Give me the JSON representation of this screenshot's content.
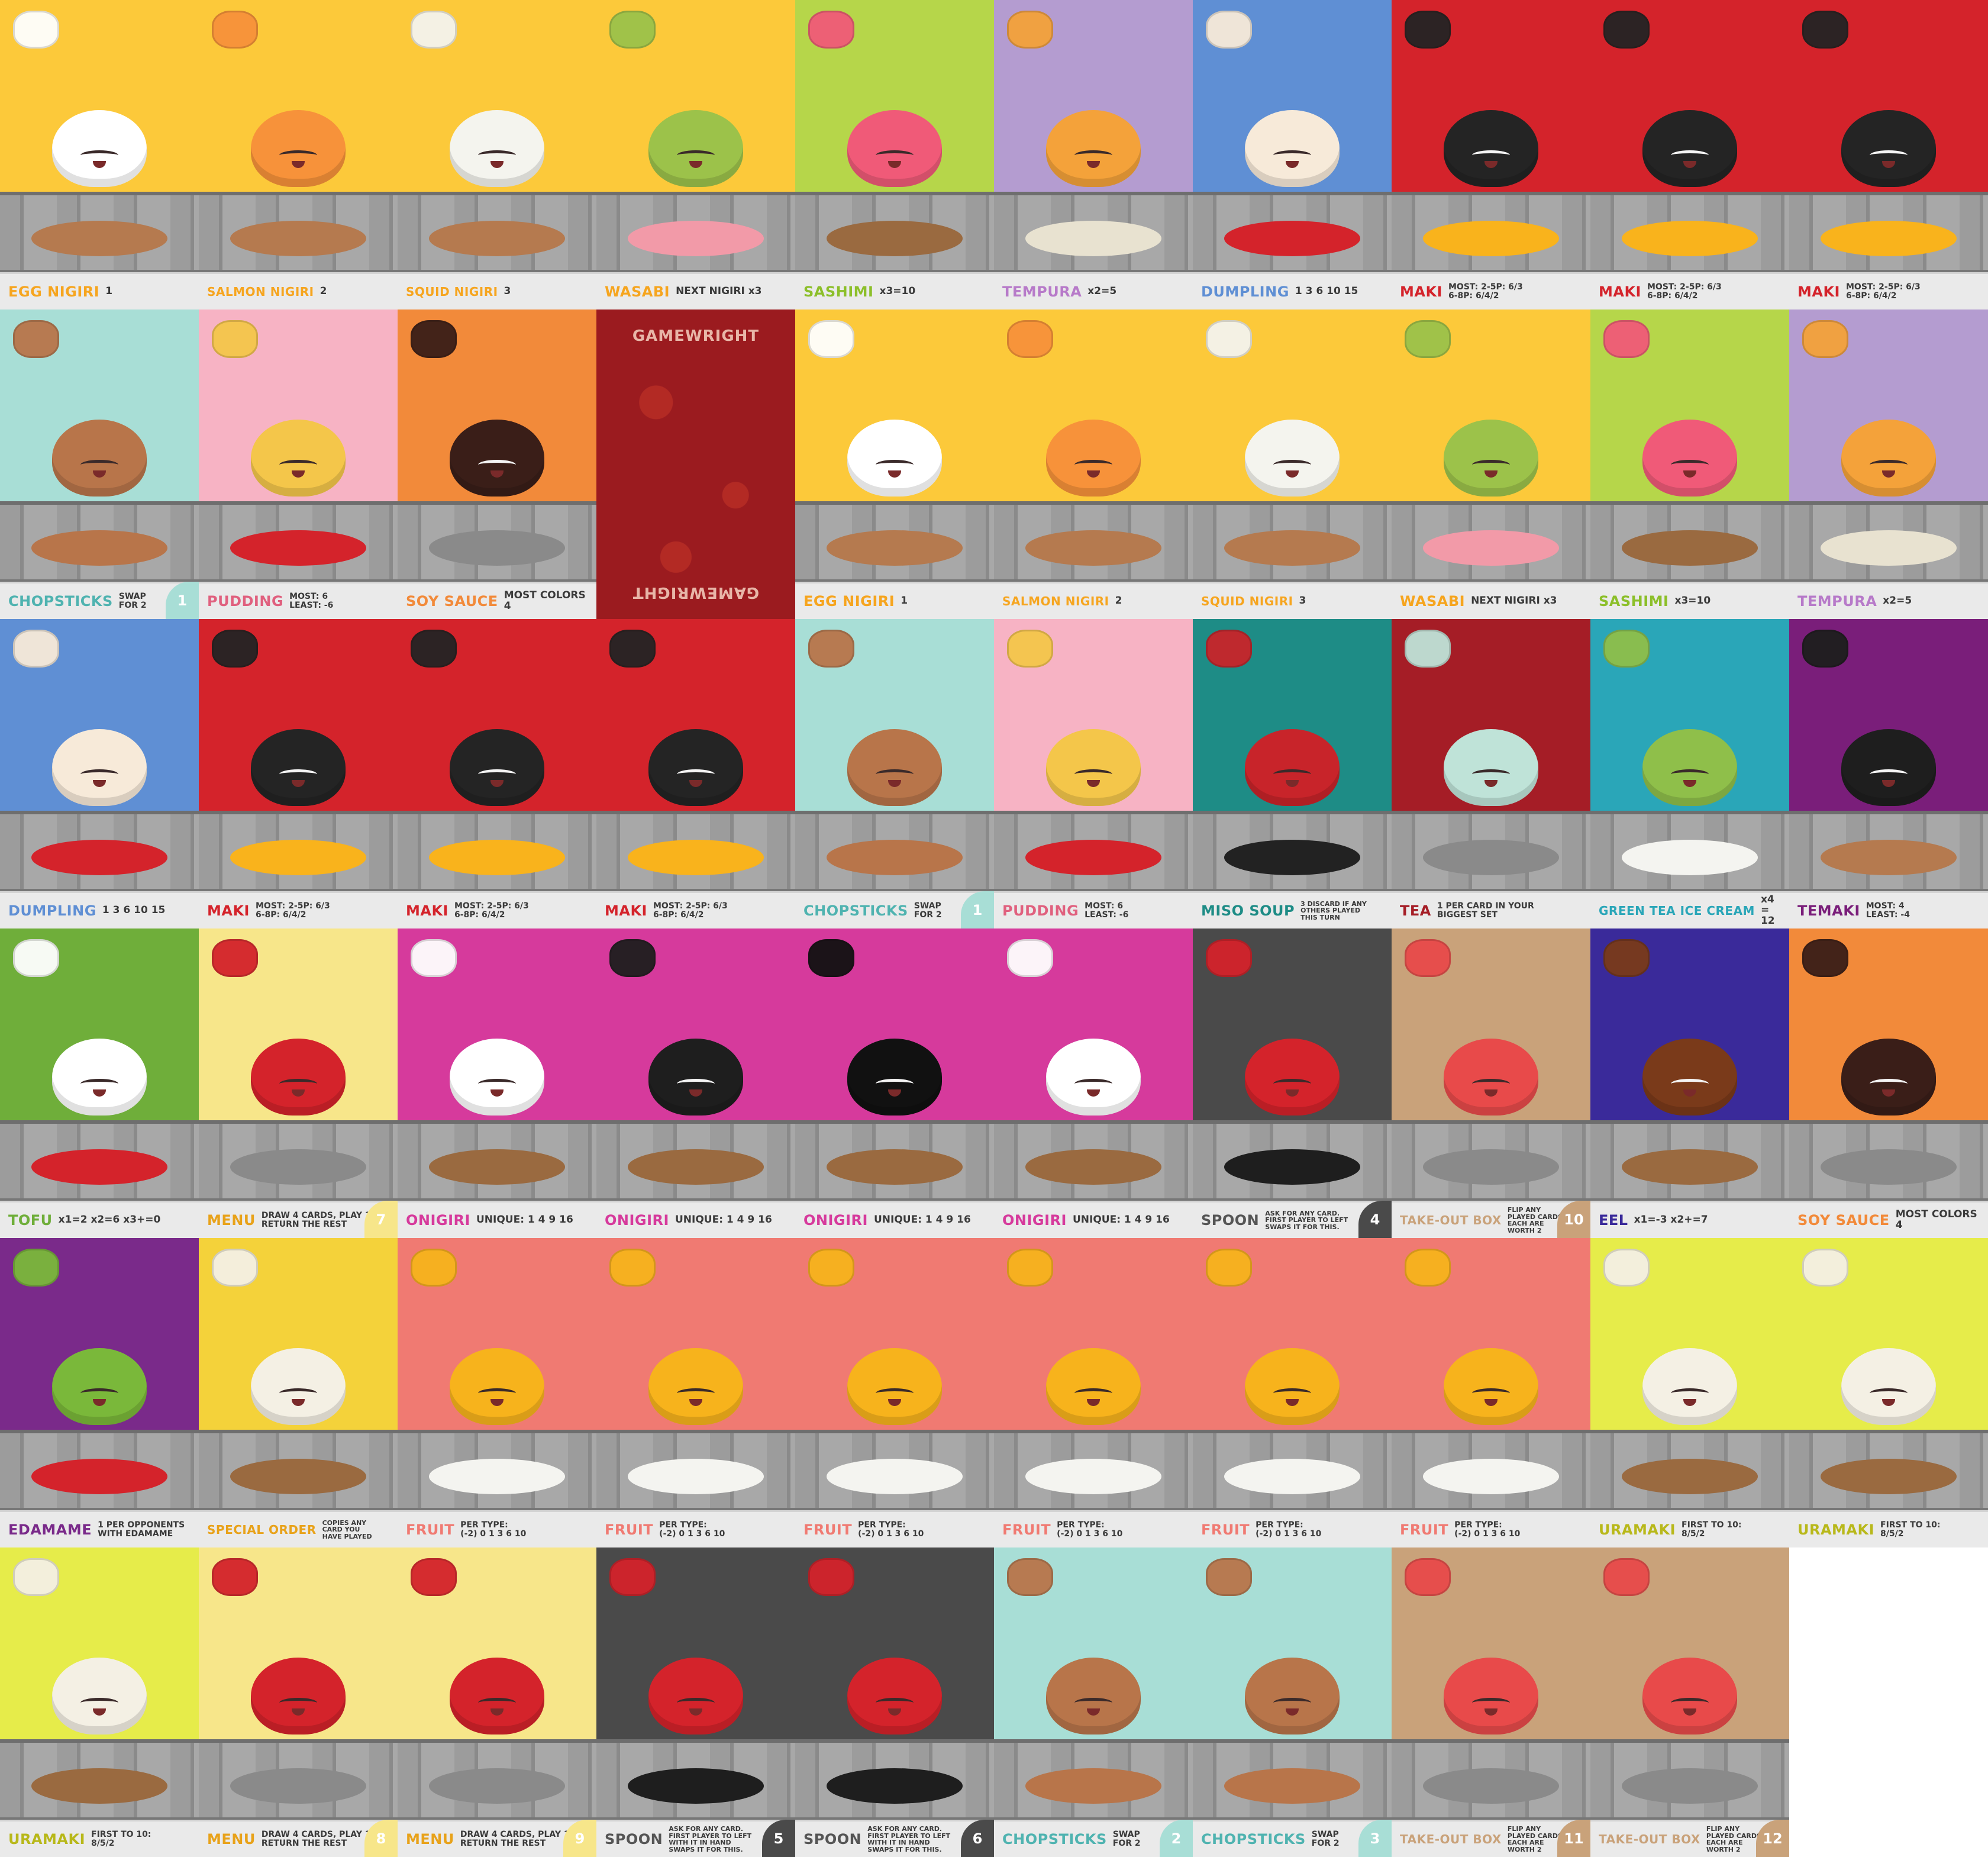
{
  "sheet": {
    "columns": 10,
    "rows": 6,
    "cards": [
      {
        "name": "EGG NIGIRI",
        "rule": "1",
        "bg": "#fcc93a",
        "name_color": "#f6a51f",
        "food": "#ffffff",
        "plate": "#b57a4f"
      },
      {
        "name": "SALMON NIGIRI",
        "rule": "2",
        "bg": "#fcc93a",
        "name_color": "#f6a51f",
        "food": "#f7923a",
        "plate": "#b57a4f"
      },
      {
        "name": "SQUID NIGIRI",
        "rule": "3",
        "bg": "#fcc93a",
        "name_color": "#f6a51f",
        "food": "#f4f4ee",
        "plate": "#b57a4f"
      },
      {
        "name": "WASABI",
        "rule": "NEXT NIGIRI x3",
        "bg": "#fcc93a",
        "name_color": "#f6a51f",
        "food": "#9cc24a",
        "plate": "#f29aa8"
      },
      {
        "name": "SASHIMI",
        "rule": "x3=10",
        "bg": "#b6d64a",
        "name_color": "#8cbf2a",
        "food": "#f05a78",
        "plate": "#9a6a40"
      },
      {
        "name": "TEMPURA",
        "rule": "x2=5",
        "bg": "#b49cd0",
        "name_color": "#b77ac9",
        "food": "#f4a23a",
        "plate": "#e8e2d0"
      },
      {
        "name": "DUMPLING",
        "rule": "1 3 6 10 15",
        "bg": "#5f8fd4",
        "name_color": "#5f8fd4",
        "food": "#f7ead9",
        "plate": "#d4232b"
      },
      {
        "name": "MAKI",
        "rule": "MOST: 2-5P: 6/3\n6-8P: 6/4/2",
        "bg": "#d4232b",
        "name_color": "#d4232b",
        "food": "#242424",
        "plate": "#f9b31c"
      },
      {
        "name": "MAKI",
        "rule": "MOST: 2-5P: 6/3\n6-8P: 6/4/2",
        "bg": "#d4232b",
        "name_color": "#d4232b",
        "food": "#242424",
        "plate": "#f9b31c"
      },
      {
        "name": "MAKI",
        "rule": "MOST: 2-5P: 6/3\n6-8P: 6/4/2",
        "bg": "#d4232b",
        "name_color": "#d4232b",
        "food": "#242424",
        "plate": "#f9b31c"
      },
      {
        "name": "CHOPSTICKS",
        "rule": "SWAP\nFOR 2",
        "num": "1",
        "bg": "#a8ded6",
        "name_color": "#4fb3b0",
        "food": "#b8754a",
        "plate": "#b8754a"
      },
      {
        "name": "PUDDING",
        "rule": "MOST: 6\nLEAST: -6",
        "bg": "#f7b3c4",
        "name_color": "#e0607e",
        "food": "#f4c64a",
        "plate": "#d4232b"
      },
      {
        "name": "SOY SAUCE",
        "rule": "MOST COLORS 4",
        "bg": "#f28a3a",
        "name_color": "#f28a3a",
        "food": "#3a1e18",
        "plate": "#8a8a8a"
      },
      {
        "name": "",
        "rule": "",
        "back": true,
        "brand": "GAMEWRIGHT"
      },
      {
        "name": "EGG NIGIRI",
        "rule": "1",
        "bg": "#fcc93a",
        "name_color": "#f6a51f",
        "food": "#ffffff",
        "plate": "#b57a4f"
      },
      {
        "name": "SALMON NIGIRI",
        "rule": "2",
        "bg": "#fcc93a",
        "name_color": "#f6a51f",
        "food": "#f7923a",
        "plate": "#b57a4f"
      },
      {
        "name": "SQUID NIGIRI",
        "rule": "3",
        "bg": "#fcc93a",
        "name_color": "#f6a51f",
        "food": "#f4f4ee",
        "plate": "#b57a4f"
      },
      {
        "name": "WASABI",
        "rule": "NEXT NIGIRI x3",
        "bg": "#fcc93a",
        "name_color": "#f6a51f",
        "food": "#9cc24a",
        "plate": "#f29aa8"
      },
      {
        "name": "SASHIMI",
        "rule": "x3=10",
        "bg": "#b6d64a",
        "name_color": "#8cbf2a",
        "food": "#f05a78",
        "plate": "#9a6a40"
      },
      {
        "name": "TEMPURA",
        "rule": "x2=5",
        "bg": "#b49cd0",
        "name_color": "#b77ac9",
        "food": "#f4a23a",
        "plate": "#e8e2d0"
      },
      {
        "name": "DUMPLING",
        "rule": "1 3 6 10 15",
        "bg": "#5f8fd4",
        "name_color": "#5f8fd4",
        "food": "#f7ead9",
        "plate": "#d4232b"
      },
      {
        "name": "MAKI",
        "rule": "MOST: 2-5P: 6/3\n6-8P: 6/4/2",
        "bg": "#d4232b",
        "name_color": "#d4232b",
        "food": "#242424",
        "plate": "#f9b31c"
      },
      {
        "name": "MAKI",
        "rule": "MOST: 2-5P: 6/3\n6-8P: 6/4/2",
        "bg": "#d4232b",
        "name_color": "#d4232b",
        "food": "#242424",
        "plate": "#f9b31c"
      },
      {
        "name": "MAKI",
        "rule": "MOST: 2-5P: 6/3\n6-8P: 6/4/2",
        "bg": "#d4232b",
        "name_color": "#d4232b",
        "food": "#242424",
        "plate": "#f9b31c"
      },
      {
        "name": "CHOPSTICKS",
        "rule": "SWAP\nFOR 2",
        "num": "1",
        "bg": "#a8ded6",
        "name_color": "#4fb3b0",
        "food": "#b8754a",
        "plate": "#b8754a"
      },
      {
        "name": "PUDDING",
        "rule": "MOST: 6\nLEAST: -6",
        "bg": "#f7b3c4",
        "name_color": "#e0607e",
        "food": "#f4c64a",
        "plate": "#d4232b"
      },
      {
        "name": "MISO SOUP",
        "rule": "3  DISCARD IF ANY\nOTHERS PLAYED\nTHIS TURN",
        "bg": "#1e8c86",
        "name_color": "#1e8c86",
        "food": "#c8242a",
        "plate": "#222222"
      },
      {
        "name": "TEA",
        "rule": "1  PER CARD IN YOUR\nBIGGEST SET",
        "bg": "#a51d26",
        "name_color": "#a51d26",
        "food": "#bfe3d8",
        "plate": "#8a8a8a"
      },
      {
        "name": "GREEN TEA ICE CREAM",
        "rule": "x4 = 12",
        "bg": "#2aa6b8",
        "name_color": "#2aa6b8",
        "food": "#8fbf4a",
        "plate": "#f4f4f0"
      },
      {
        "name": "TEMAKI",
        "rule": "MOST: 4\nLEAST: -4",
        "bg": "#7a1e7a",
        "name_color": "#7a1e7a",
        "food": "#1e1e1e",
        "plate": "#b57a4f"
      },
      {
        "name": "TOFU",
        "rule": "x1=2   x2=6   x3+=0",
        "bg": "#6fae3a",
        "name_color": "#6fae3a",
        "food": "#ffffff",
        "plate": "#d4232b"
      },
      {
        "name": "MENU",
        "rule": "DRAW 4 CARDS, PLAY 1,\nRETURN THE REST",
        "num": "7",
        "bg": "#f7e68a",
        "name_color": "#e8a21a",
        "food": "#d4232b",
        "plate": "#8a8a8a"
      },
      {
        "name": "ONIGIRI",
        "rule": "UNIQUE: 1 4 9 16",
        "bg": "#d63a9c",
        "name_color": "#d63a9c",
        "food": "#ffffff",
        "plate": "#9a6a40"
      },
      {
        "name": "ONIGIRI",
        "rule": "UNIQUE: 1 4 9 16",
        "bg": "#d63a9c",
        "name_color": "#d63a9c",
        "food": "#1e1e1e",
        "plate": "#9a6a40"
      },
      {
        "name": "ONIGIRI",
        "rule": "UNIQUE: 1 4 9 16",
        "bg": "#d63a9c",
        "name_color": "#d63a9c",
        "food": "#111111",
        "plate": "#9a6a40"
      },
      {
        "name": "ONIGIRI",
        "rule": "UNIQUE: 1 4 9 16",
        "bg": "#d63a9c",
        "name_color": "#d63a9c",
        "food": "#ffffff",
        "plate": "#9a6a40"
      },
      {
        "name": "SPOON",
        "rule": "ASK FOR ANY CARD.\nFIRST PLAYER TO LEFT\nSWAPS IT FOR THIS.",
        "num": "4",
        "bg": "#4a4a4a",
        "name_color": "#555555",
        "food": "#d4232b",
        "plate": "#1e1e1e"
      },
      {
        "name": "TAKE-OUT BOX",
        "rule": "FLIP ANY\nPLAYED CARDS.\nEACH ARE\nWORTH 2",
        "num": "10",
        "bg": "#c9a27a",
        "name_color": "#c9a27a",
        "food": "#e84a4a",
        "plate": "#8a8a8a"
      },
      {
        "name": "EEL",
        "rule": "x1=-3   x2+=7",
        "bg": "#3a2a9a",
        "name_color": "#3a2a9a",
        "food": "#7a3a1a",
        "plate": "#9a6a40"
      },
      {
        "name": "SOY SAUCE",
        "rule": "MOST COLORS 4",
        "bg": "#f28a3a",
        "name_color": "#f28a3a",
        "food": "#3a1e18",
        "plate": "#8a8a8a"
      },
      {
        "name": "EDAMAME",
        "rule": "1  PER OPPONENTS\nWITH EDAMAME",
        "bg": "#7a2a8a",
        "name_color": "#7a2a8a",
        "food": "#7ab83a",
        "plate": "#d4232b"
      },
      {
        "name": "SPECIAL ORDER",
        "rule": "COPIES ANY\nCARD YOU\nHAVE PLAYED",
        "bg": "#f4d23a",
        "name_color": "#e8a21a",
        "food": "#f4f0e4",
        "plate": "#9a6a40"
      },
      {
        "name": "FRUIT",
        "rule": "PER TYPE:\n(-2) 0 1 3 6 10",
        "bg": "#f07a72",
        "name_color": "#f07a72",
        "food": "#f7b31c",
        "plate": "#f4f4f0"
      },
      {
        "name": "FRUIT",
        "rule": "PER TYPE:\n(-2) 0 1 3 6 10",
        "bg": "#f07a72",
        "name_color": "#f07a72",
        "food": "#f7b31c",
        "plate": "#f4f4f0"
      },
      {
        "name": "FRUIT",
        "rule": "PER TYPE:\n(-2) 0 1 3 6 10",
        "bg": "#f07a72",
        "name_color": "#f07a72",
        "food": "#f7b31c",
        "plate": "#f4f4f0"
      },
      {
        "name": "FRUIT",
        "rule": "PER TYPE:\n(-2) 0 1 3 6 10",
        "bg": "#f07a72",
        "name_color": "#f07a72",
        "food": "#f7b31c",
        "plate": "#f4f4f0"
      },
      {
        "name": "FRUIT",
        "rule": "PER TYPE:\n(-2) 0 1 3 6 10",
        "bg": "#f07a72",
        "name_color": "#f07a72",
        "food": "#f7b31c",
        "plate": "#f4f4f0"
      },
      {
        "name": "FRUIT",
        "rule": "PER TYPE:\n(-2) 0 1 3 6 10",
        "bg": "#f07a72",
        "name_color": "#f07a72",
        "food": "#f7b31c",
        "plate": "#f4f4f0"
      },
      {
        "name": "URAMAKI",
        "rule": "FIRST TO 10:\n8/5/2",
        "bg": "#e6ec4a",
        "name_color": "#b8b81a",
        "food": "#f4f0e4",
        "plate": "#9a6a40"
      },
      {
        "name": "URAMAKI",
        "rule": "FIRST TO 10:\n8/5/2",
        "bg": "#e6ec4a",
        "name_color": "#b8b81a",
        "food": "#f4f0e4",
        "plate": "#9a6a40"
      },
      {
        "name": "URAMAKI",
        "rule": "FIRST TO 10:\n8/5/2",
        "bg": "#e6ec4a",
        "name_color": "#b8b81a",
        "food": "#f4f0e4",
        "plate": "#9a6a40"
      },
      {
        "name": "MENU",
        "rule": "DRAW 4 CARDS, PLAY 1,\nRETURN THE REST",
        "num": "8",
        "bg": "#f7e68a",
        "name_color": "#e8a21a",
        "food": "#d4232b",
        "plate": "#8a8a8a"
      },
      {
        "name": "MENU",
        "rule": "DRAW 4 CARDS, PLAY 1,\nRETURN THE REST",
        "num": "9",
        "bg": "#f7e68a",
        "name_color": "#e8a21a",
        "food": "#d4232b",
        "plate": "#8a8a8a"
      },
      {
        "name": "SPOON",
        "rule": "ASK FOR ANY CARD.\nFIRST PLAYER TO LEFT\nWITH IT IN HAND\nSWAPS IT FOR THIS.",
        "num": "5",
        "bg": "#4a4a4a",
        "name_color": "#555555",
        "food": "#d4232b",
        "plate": "#1e1e1e"
      },
      {
        "name": "SPOON",
        "rule": "ASK FOR ANY CARD.\nFIRST PLAYER TO LEFT\nWITH IT IN HAND\nSWAPS IT FOR THIS.",
        "num": "6",
        "bg": "#4a4a4a",
        "name_color": "#555555",
        "food": "#d4232b",
        "plate": "#1e1e1e"
      },
      {
        "name": "CHOPSTICKS",
        "rule": "SWAP\nFOR 2",
        "num": "2",
        "bg": "#a8ded6",
        "name_color": "#4fb3b0",
        "food": "#b8754a",
        "plate": "#b8754a"
      },
      {
        "name": "CHOPSTICKS",
        "rule": "SWAP\nFOR 2",
        "num": "3",
        "bg": "#a8ded6",
        "name_color": "#4fb3b0",
        "food": "#b8754a",
        "plate": "#b8754a"
      },
      {
        "name": "TAKE-OUT BOX",
        "rule": "FLIP ANY\nPLAYED CARDS.\nEACH ARE\nWORTH 2",
        "num": "11",
        "bg": "#c9a27a",
        "name_color": "#c9a27a",
        "food": "#e84a4a",
        "plate": "#8a8a8a"
      },
      {
        "name": "TAKE-OUT BOX",
        "rule": "FLIP ANY\nPLAYED CARDS.\nEACH ARE\nWORTH 2",
        "num": "12",
        "bg": "#c9a27a",
        "name_color": "#c9a27a",
        "food": "#e84a4a",
        "plate": "#8a8a8a"
      }
    ]
  }
}
